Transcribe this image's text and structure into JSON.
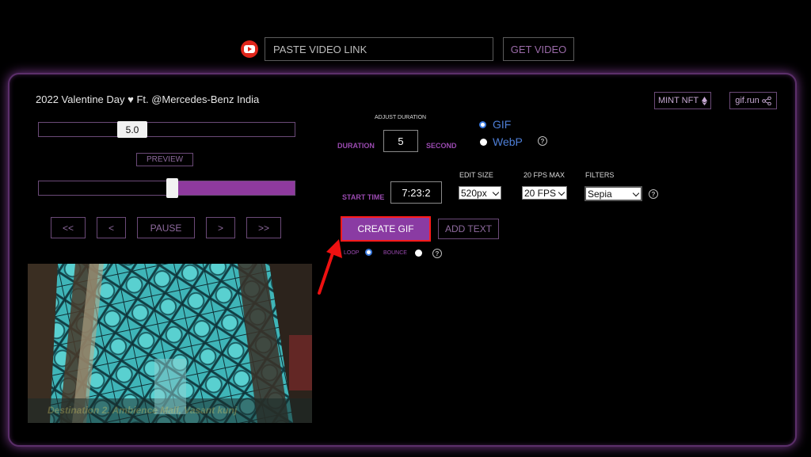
{
  "topbar": {
    "link_placeholder": "PASTE VIDEO LINK",
    "get_video_label": "GET VIDEO"
  },
  "video": {
    "title": "2022 Valentine Day ♥ Ft. @Mercedes-Benz India",
    "caption": "Destination 2. Ambience Mall, Vasant kunj"
  },
  "actions": {
    "mint_nft_label": "MINT NFT",
    "gifrun_label": "gif.run"
  },
  "speed": {
    "value": "5.0"
  },
  "preview_label": "PREVIEW",
  "seek": {
    "progress": 0.52
  },
  "controls": {
    "rewind_fast": "<<",
    "rewind": "<",
    "pause": "PAUSE",
    "forward": ">",
    "forward_fast": ">>"
  },
  "settings": {
    "adjust_duration_label": "ADJUST DURATION",
    "duration_label": "DURATION",
    "duration_value": "5",
    "second_label": "SECOND",
    "start_time_label": "START TIME",
    "start_time_value": "7:23:2",
    "edit_size_label": "EDIT SIZE",
    "edit_size_value": "520px",
    "fps_label": "20 FPS MAX",
    "fps_value": "20 FPS",
    "filters_label": "FILTERS",
    "filter_value": "Sepia"
  },
  "format": {
    "options": [
      "GIF",
      "WebP"
    ],
    "selected": "GIF"
  },
  "create_gif_label": "CREATE GIF",
  "add_text_label": "ADD TEXT",
  "playback": {
    "loop_label": "LOOP",
    "bounce_label": "BOUNCE",
    "selected": "LOOP"
  },
  "colors": {
    "accent": "#8a3ba3",
    "highlight_border": "#ff1a1a",
    "link_blue": "#4e7fd8"
  },
  "icons": {
    "youtube": "youtube-icon",
    "ethereum": "ethereum-icon",
    "share": "share-icon",
    "help": "help-icon",
    "arrow": "red-arrow-icon"
  }
}
